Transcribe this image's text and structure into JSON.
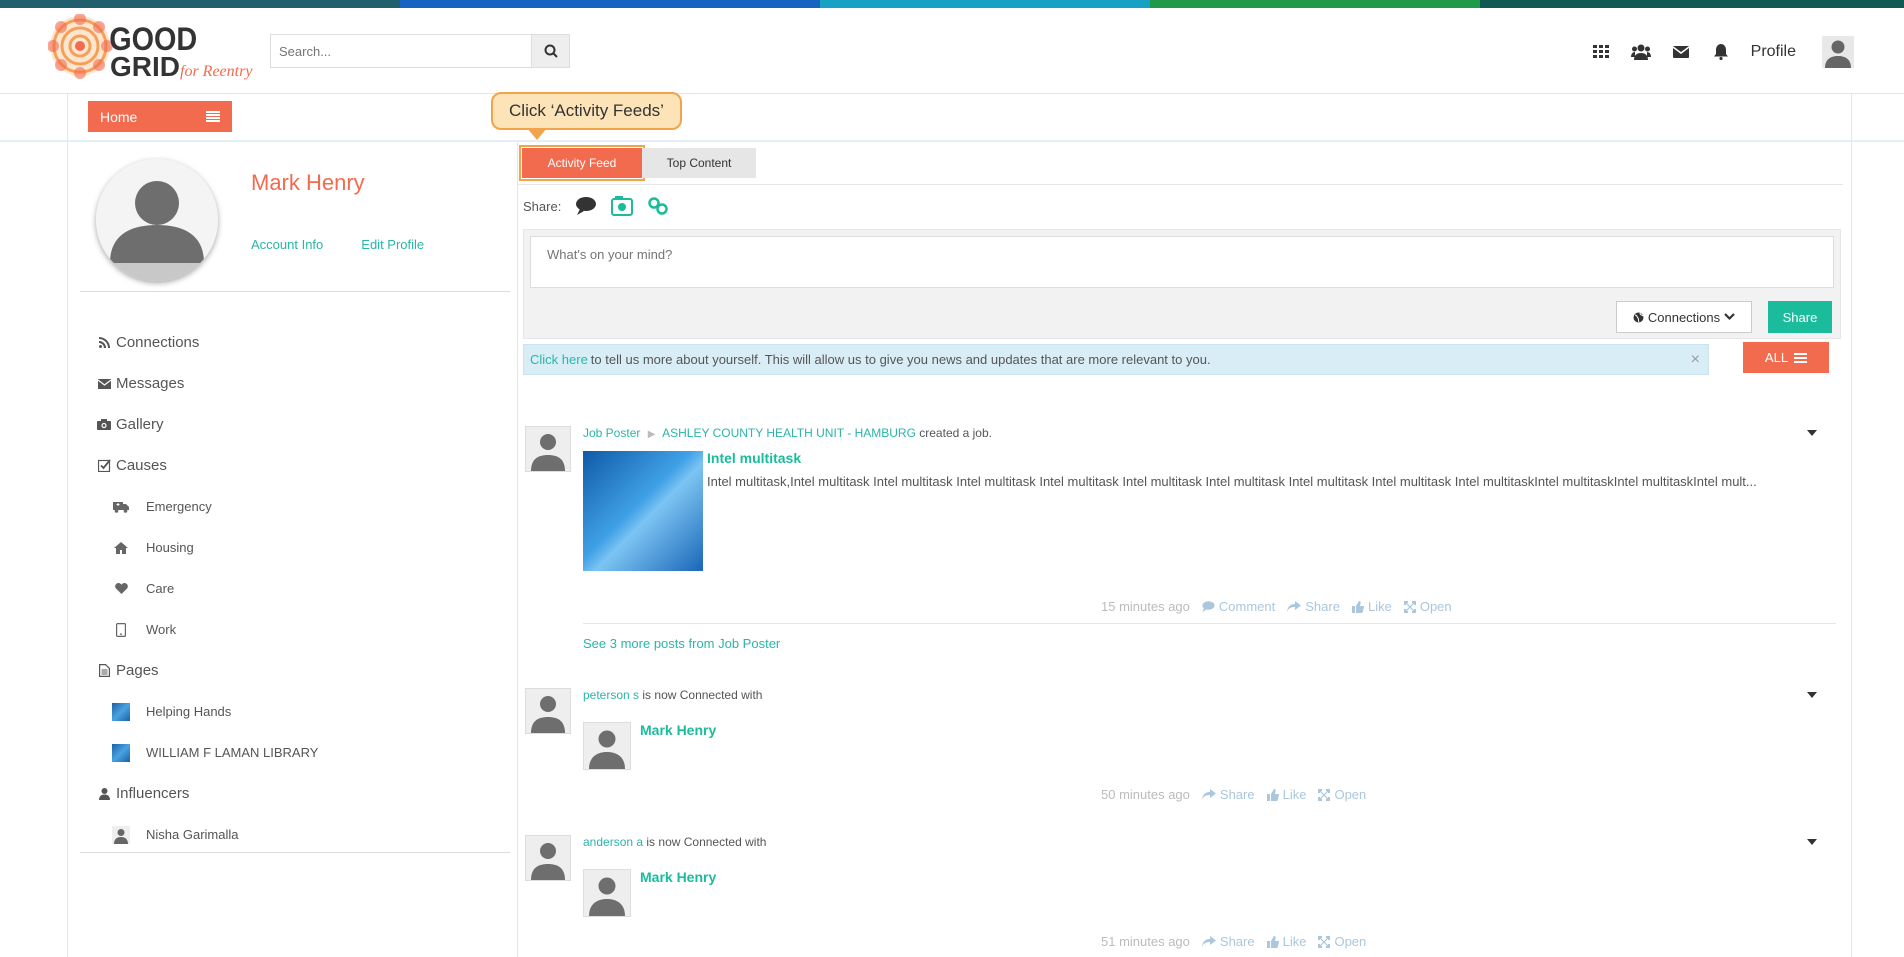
{
  "colors": {
    "accent": "#f26b4f",
    "teal": "#1abc9c",
    "link": "#2bb5a8",
    "stripe": [
      "#1f5f6e",
      "#1565c0",
      "#17a2c4",
      "#1f9a4a",
      "#0f5a52"
    ]
  },
  "header": {
    "logo_text": "THE GOOD GRID for Reentry",
    "search_placeholder": "Search...",
    "icons": [
      "apps-grid-icon",
      "group-icon",
      "envelope-icon",
      "bell-icon"
    ],
    "profile_label": "Profile"
  },
  "nav": {
    "home_label": "Home"
  },
  "callout": {
    "text": "Click ‘Activity Feeds’"
  },
  "sidebar": {
    "user_name": "Mark Henry",
    "account_info": "Account Info",
    "edit_profile": "Edit Profile",
    "items": {
      "connections": "Connections",
      "messages": "Messages",
      "gallery": "Gallery",
      "causes": "Causes",
      "emergency": "Emergency",
      "housing": "Housing",
      "care": "Care",
      "work": "Work",
      "pages": "Pages",
      "helping_hands": "Helping Hands",
      "library": "WILLIAM F LAMAN LIBRARY",
      "influencers": "Influencers",
      "nisha": "Nisha Garimalla"
    }
  },
  "main": {
    "tabs": {
      "activity": "Activity Feed",
      "top": "Top Content"
    },
    "share_label": "Share:",
    "composer_placeholder": "What's on your mind?",
    "connections_btn": "Connections",
    "share_btn": "Share",
    "info_link": "Click here",
    "info_text": "to tell us more about yourself. This will allow us to give you news and updates that are more relevant to you.",
    "all_btn": "ALL",
    "posts": [
      {
        "author": "Job Poster",
        "target": "ASHLEY COUNTY HEALTH UNIT - HAMBURG",
        "verb": "created a job.",
        "title": "Intel multitask",
        "desc": "Intel multitask,Intel multitask Intel multitask Intel multitask Intel multitask Intel multitask Intel multitask Intel multitask Intel multitask  Intel multitaskIntel multitaskIntel multitaskIntel mult...",
        "time": "15 minutes ago",
        "comment": "Comment",
        "share": "Share",
        "like": "Like",
        "open": "Open",
        "more": "See 3 more posts from Job Poster"
      },
      {
        "author": "peterson s",
        "verb": "is now Connected with",
        "connected": "Mark Henry",
        "time": "50 minutes ago",
        "share": "Share",
        "like": "Like",
        "open": "Open"
      },
      {
        "author": "anderson a",
        "verb": "is now Connected with",
        "connected": "Mark Henry",
        "time": "51 minutes ago",
        "share": "Share",
        "like": "Like",
        "open": "Open"
      }
    ]
  }
}
